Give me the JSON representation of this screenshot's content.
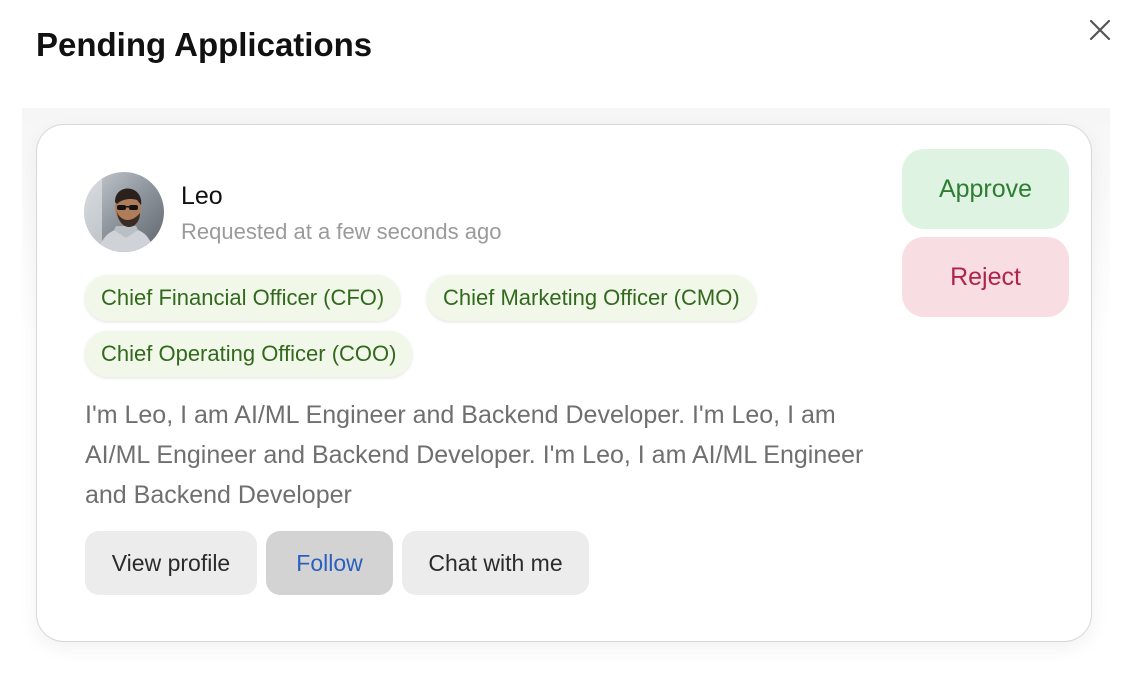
{
  "modal": {
    "title": "Pending Applications"
  },
  "application": {
    "name": "Leo",
    "requested": "Requested at a few seconds ago",
    "roles": [
      "Chief Financial Officer (CFO)",
      "Chief Marketing Officer (CMO)",
      "Chief Operating Officer (COO)"
    ],
    "bio": "I'm Leo, I am AI/ML Engineer and Backend Developer. I'm Leo, I am AI/ML Engineer and Backend Developer. I'm Leo, I am AI/ML Engineer and Backend Developer",
    "actions": {
      "view_profile": "View profile",
      "follow": "Follow",
      "chat": "Chat with me"
    },
    "decisions": {
      "approve": "Approve",
      "reject": "Reject"
    }
  },
  "icons": {
    "close": "close-icon",
    "avatar": "avatar"
  },
  "colors": {
    "approve_bg": "#dff3e2",
    "approve_text": "#2e7d32",
    "reject_bg": "#f8dde3",
    "reject_text": "#b0244a",
    "chip_bg": "#f1f8e9",
    "chip_text": "#33691e",
    "follow_text": "#2b5fbf"
  }
}
